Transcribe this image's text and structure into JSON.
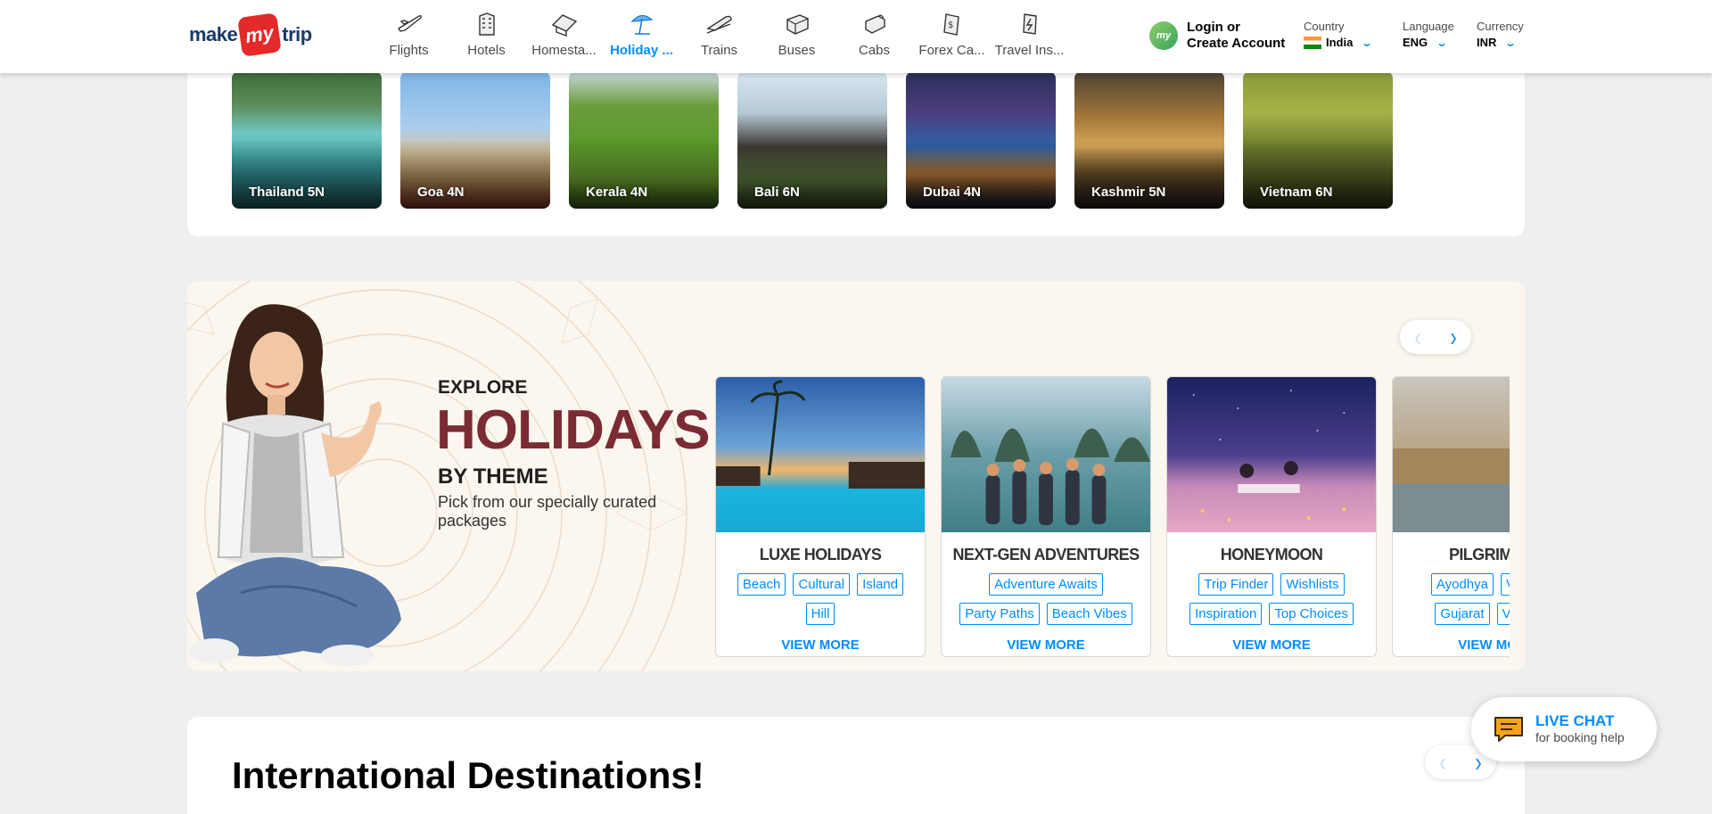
{
  "header": {
    "logo": {
      "part1": "make",
      "part2": "my",
      "part3": "trip"
    },
    "nav": [
      {
        "label": "Flights",
        "icon": "flight-icon"
      },
      {
        "label": "Hotels",
        "icon": "hotel-icon"
      },
      {
        "label": "Homesta...",
        "icon": "homestay-icon"
      },
      {
        "label": "Holiday ...",
        "icon": "holiday-icon",
        "active": true
      },
      {
        "label": "Trains",
        "icon": "train-icon"
      },
      {
        "label": "Buses",
        "icon": "bus-icon"
      },
      {
        "label": "Cabs",
        "icon": "cab-icon"
      },
      {
        "label": "Forex Ca...",
        "icon": "forex-card-icon"
      },
      {
        "label": "Travel Ins...",
        "icon": "travel-insurance-icon"
      }
    ],
    "login": {
      "badge": "my",
      "line1": "Login or",
      "line2": "Create Account"
    },
    "country": {
      "label": "Country",
      "value": "India"
    },
    "language": {
      "label": "Language",
      "value": "ENG"
    },
    "currency": {
      "label": "Currency",
      "value": "INR"
    }
  },
  "holiday_strip": [
    {
      "label": "Thailand 5N"
    },
    {
      "label": "Goa 4N"
    },
    {
      "label": "Kerala 4N"
    },
    {
      "label": "Bali 6N"
    },
    {
      "label": "Dubai 4N"
    },
    {
      "label": "Kashmir 5N"
    },
    {
      "label": "Vietnam 6N"
    }
  ],
  "theme": {
    "line1": "EXPLORE",
    "line2": "HOLIDAYS",
    "line3": "BY THEME",
    "subtitle": "Pick from our specially curated packages",
    "cards": [
      {
        "title": "LUXE HOLIDAYS",
        "chips": [
          "Beach",
          "Cultural",
          "Island",
          "Hill"
        ],
        "cta": "VIEW MORE"
      },
      {
        "title": "NEXT-GEN ADVENTURES",
        "chips": [
          "Adventure Awaits",
          "Party Paths",
          "Beach Vibes"
        ],
        "cta": "VIEW MORE"
      },
      {
        "title": "HONEYMOON",
        "chips": [
          "Trip Finder",
          "Wishlists",
          "Inspiration",
          "Top Choices"
        ],
        "cta": "VIEW MORE"
      },
      {
        "title": "PILGRIMAGE",
        "chips": [
          "Ayodhya",
          "Varanasi",
          "Gujarat",
          "Varanasi"
        ],
        "cta": "VIEW MORE"
      }
    ]
  },
  "international": {
    "title": "International Destinations!"
  },
  "live_chat": {
    "title": "LIVE CHAT",
    "subtitle": "for booking help"
  }
}
